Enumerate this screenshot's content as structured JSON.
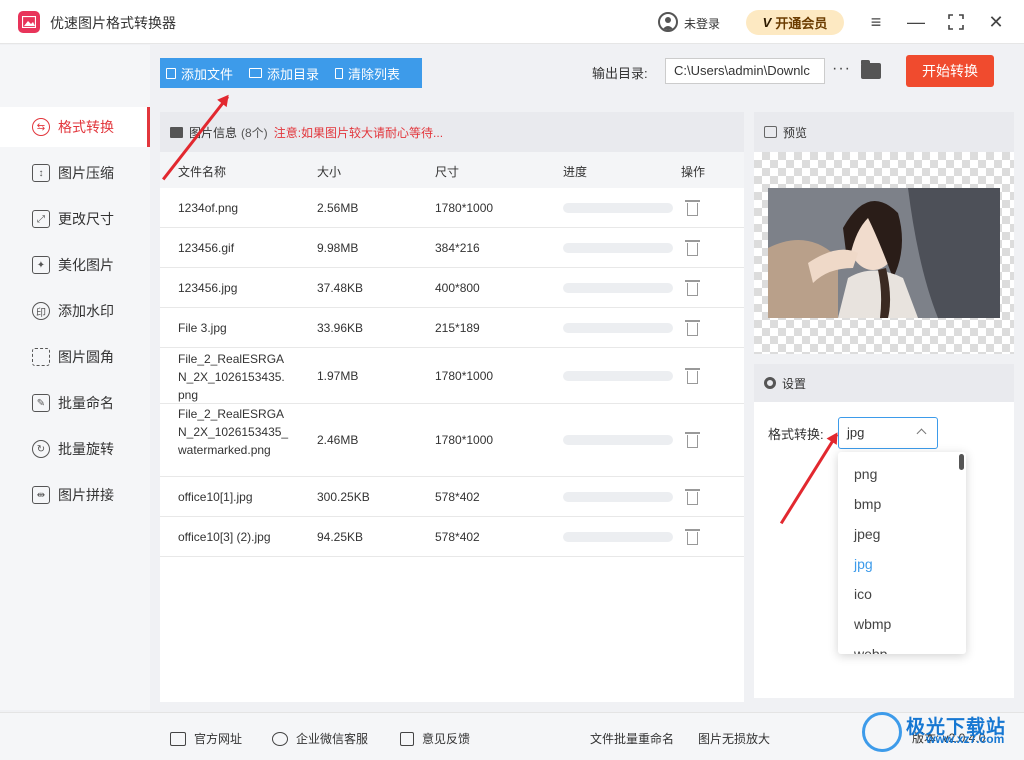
{
  "app": {
    "title": "优速图片格式转换器",
    "user_label": "未登录",
    "vip_label": "开通会员",
    "vip_icon": "V"
  },
  "sidebar": {
    "items": [
      {
        "label": "格式转换",
        "icon": "format-convert-icon"
      },
      {
        "label": "图片压缩",
        "icon": "compress-icon"
      },
      {
        "label": "更改尺寸",
        "icon": "resize-icon"
      },
      {
        "label": "美化图片",
        "icon": "beautify-icon"
      },
      {
        "label": "添加水印",
        "icon": "watermark-icon"
      },
      {
        "label": "图片圆角",
        "icon": "round-corner-icon"
      },
      {
        "label": "批量命名",
        "icon": "rename-icon"
      },
      {
        "label": "批量旋转",
        "icon": "rotate-icon"
      },
      {
        "label": "图片拼接",
        "icon": "stitch-icon"
      }
    ],
    "active_index": 0
  },
  "toolbar": {
    "add_file": "添加文件",
    "add_folder": "添加目录",
    "clear_list": "清除列表",
    "output_label": "输出目录:",
    "output_path": "C:\\Users\\admin\\Downlc",
    "more": "···",
    "start": "开始转换"
  },
  "files": {
    "title": "图片信息",
    "count": "(8个)",
    "note": "注意:如果图片较大请耐心等待...",
    "columns": [
      "文件名称",
      "大小",
      "尺寸",
      "进度",
      "操作"
    ],
    "rows": [
      {
        "name": "1234of.png",
        "size": "2.56MB",
        "dim": "1780*1000",
        "progress": 0
      },
      {
        "name": "123456.gif",
        "size": "9.98MB",
        "dim": "384*216",
        "progress": 0
      },
      {
        "name": "123456.jpg",
        "size": "37.48KB",
        "dim": "400*800",
        "progress": 0
      },
      {
        "name": "File 3.jpg",
        "size": "33.96KB",
        "dim": "215*189",
        "progress": 0
      },
      {
        "name": "File_2_RealESRGAN_2X_1026153435.png",
        "size": "1.97MB",
        "dim": "1780*1000",
        "progress": 0
      },
      {
        "name": "File_2_RealESRGAN_2X_1026153435_watermarked.png",
        "size": "2.46MB",
        "dim": "1780*1000",
        "progress": 0
      },
      {
        "name": "office10[1].jpg",
        "size": "300.25KB",
        "dim": "578*402",
        "progress": 0
      },
      {
        "name": "office10[3] (2).jpg",
        "size": "94.25KB",
        "dim": "578*402",
        "progress": 0
      }
    ]
  },
  "preview": {
    "title": "预览"
  },
  "settings": {
    "title": "设置",
    "format_label": "格式转换:",
    "format_value": "jpg",
    "options": [
      "png",
      "bmp",
      "jpeg",
      "jpg",
      "ico",
      "wbmp",
      "webp"
    ],
    "selected": "jpg"
  },
  "footer": {
    "website": "官方网址",
    "wechat": "企业微信客服",
    "feedback": "意见反馈",
    "batch_rename": "文件批量重命名",
    "upscale": "图片无损放大",
    "version": "版本: v2.0.4.0"
  },
  "watermark": {
    "text": "极光下载站",
    "url": "www.xz7.com"
  },
  "colors": {
    "accent": "#3d9bea",
    "active": "#e2363c",
    "start": "#f04b2e"
  }
}
